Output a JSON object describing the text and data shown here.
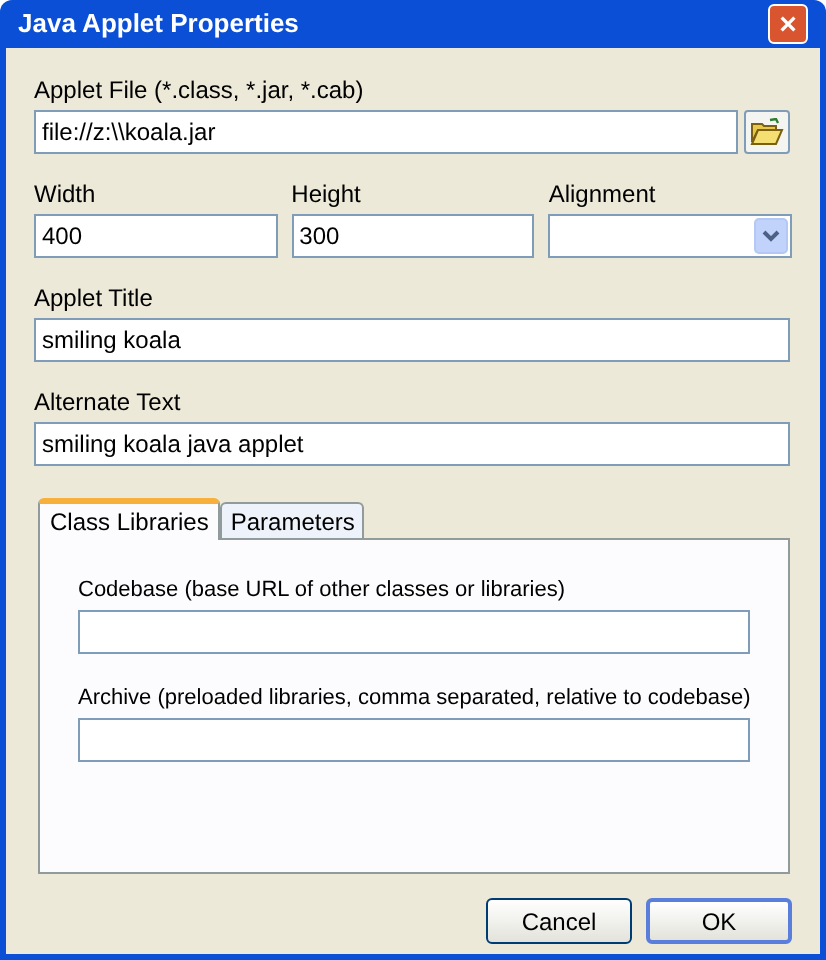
{
  "window": {
    "title": "Java Applet Properties",
    "close_button": "×"
  },
  "applet_file": {
    "label": "Applet File (*.class, *.jar, *.cab)",
    "value": "file://z:\\\\koala.jar"
  },
  "size_fields": [
    {
      "label": "Width",
      "value": "400",
      "kind": "text"
    },
    {
      "label": "Height",
      "value": "300",
      "kind": "text"
    },
    {
      "label": "Alignment",
      "kind": "dropdown"
    }
  ],
  "applet_title": {
    "label": "Applet Title",
    "value": "smiling koala"
  },
  "alternate_text": {
    "label": "Alternate Text",
    "value": "smiling koala java applet"
  },
  "tabs": [
    {
      "label": "Class Libraries",
      "selected": true
    },
    {
      "label": "Parameters",
      "selected": false
    }
  ],
  "tab_fields": [
    {
      "label": "Codebase (base URL of other classes or libraries)"
    },
    {
      "label": "Archive (preloaded libraries, comma separated, relative to codebase)"
    }
  ],
  "buttons": [
    {
      "label": "Cancel",
      "default": false
    },
    {
      "label": "OK",
      "default": true
    }
  ]
}
